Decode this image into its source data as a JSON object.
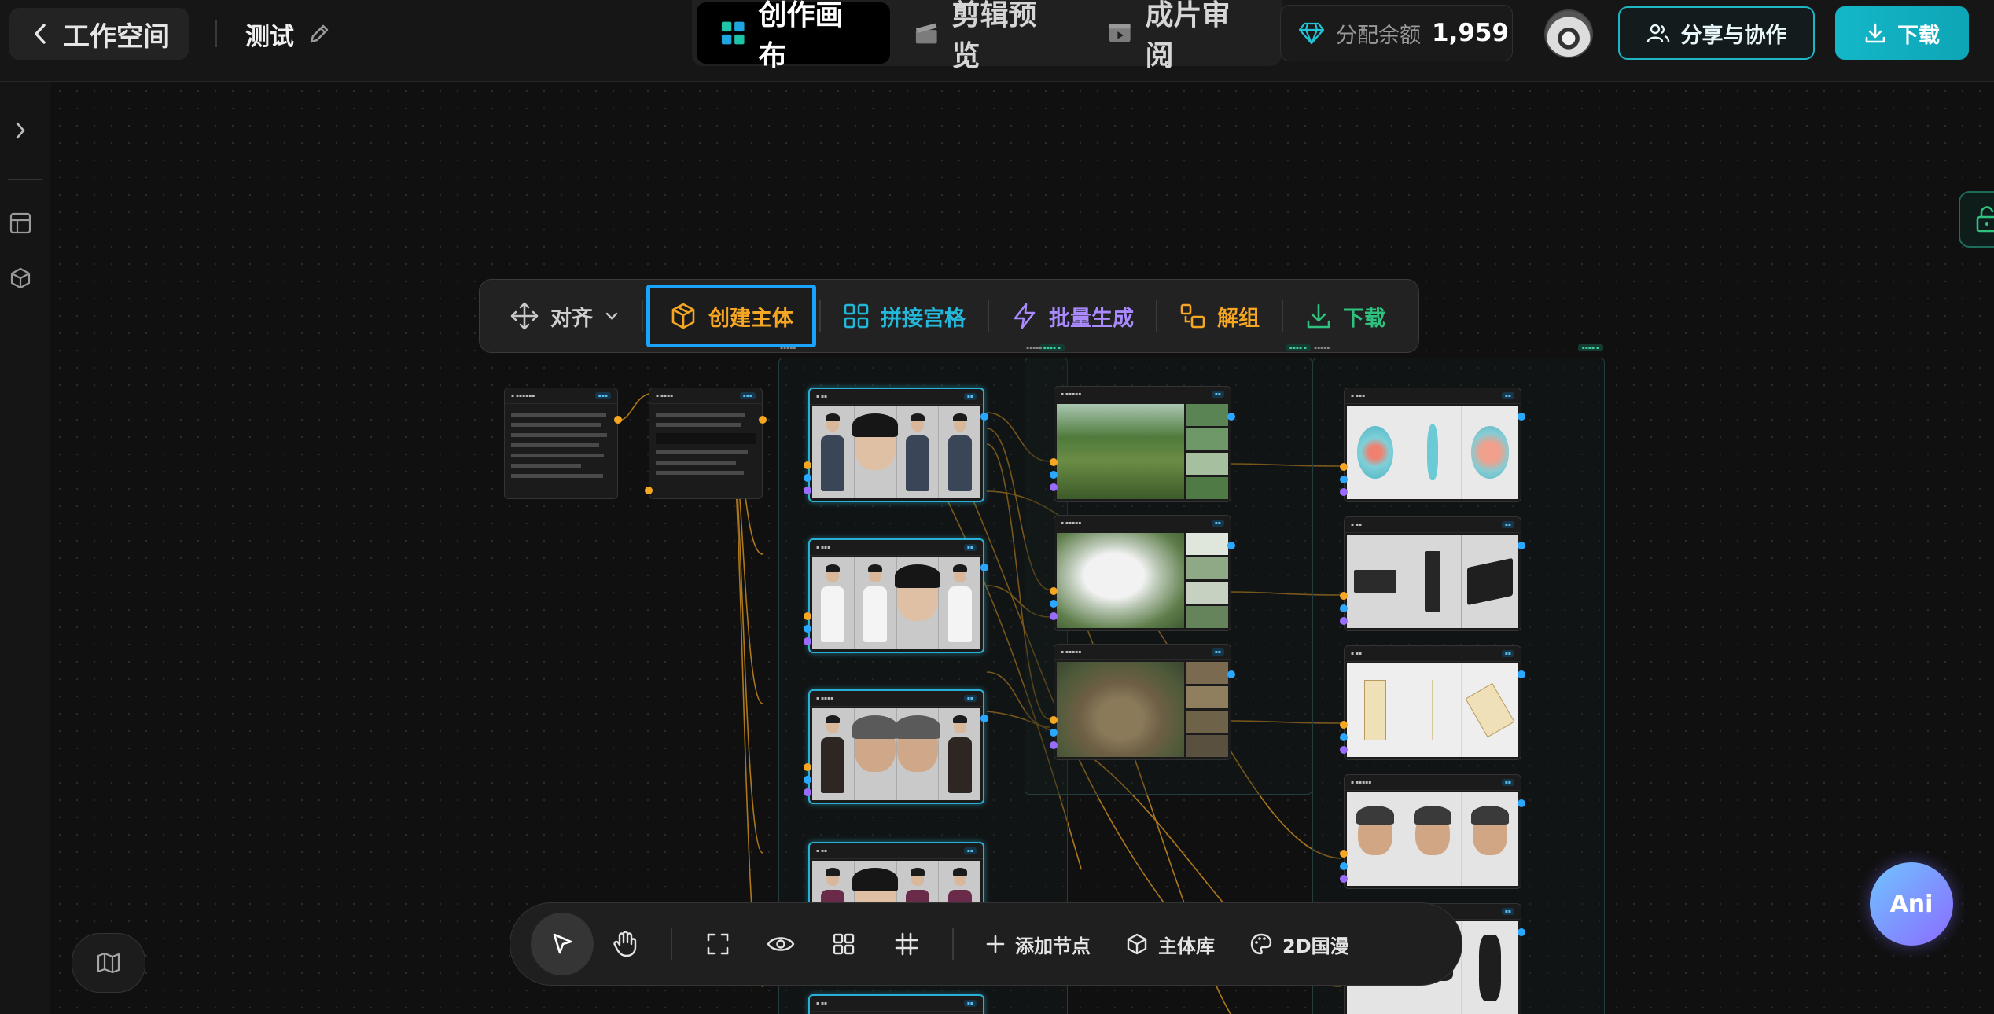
{
  "header": {
    "back_label": "工作空间",
    "doc_title": "测试",
    "tabs": [
      {
        "label": "创作画布",
        "active": true
      },
      {
        "label": "剪辑预览",
        "active": false
      },
      {
        "label": "成片审阅",
        "active": false
      }
    ],
    "balance_label": "分配余额",
    "balance_value": "1,959",
    "share_label": "分享与协作",
    "download_label": "下载"
  },
  "canvas_toolbar": {
    "align_label": "对齐",
    "create_subject_label": "创建主体",
    "grid_stitch_label": "拼接宫格",
    "batch_generate_label": "批量生成",
    "ungroup_label": "解组",
    "download_label": "下载"
  },
  "bottom_toolbar": {
    "add_node_label": "添加节点",
    "subject_library_label": "主体库",
    "style_label": "2D国漫"
  },
  "assistant_label": "Ani",
  "colors": {
    "accent_teal": "#13b7c8",
    "accent_orange": "#f5a623",
    "accent_purple": "#a98bff",
    "accent_green": "#2ec27e",
    "selection_blue": "#1aa4ff"
  }
}
